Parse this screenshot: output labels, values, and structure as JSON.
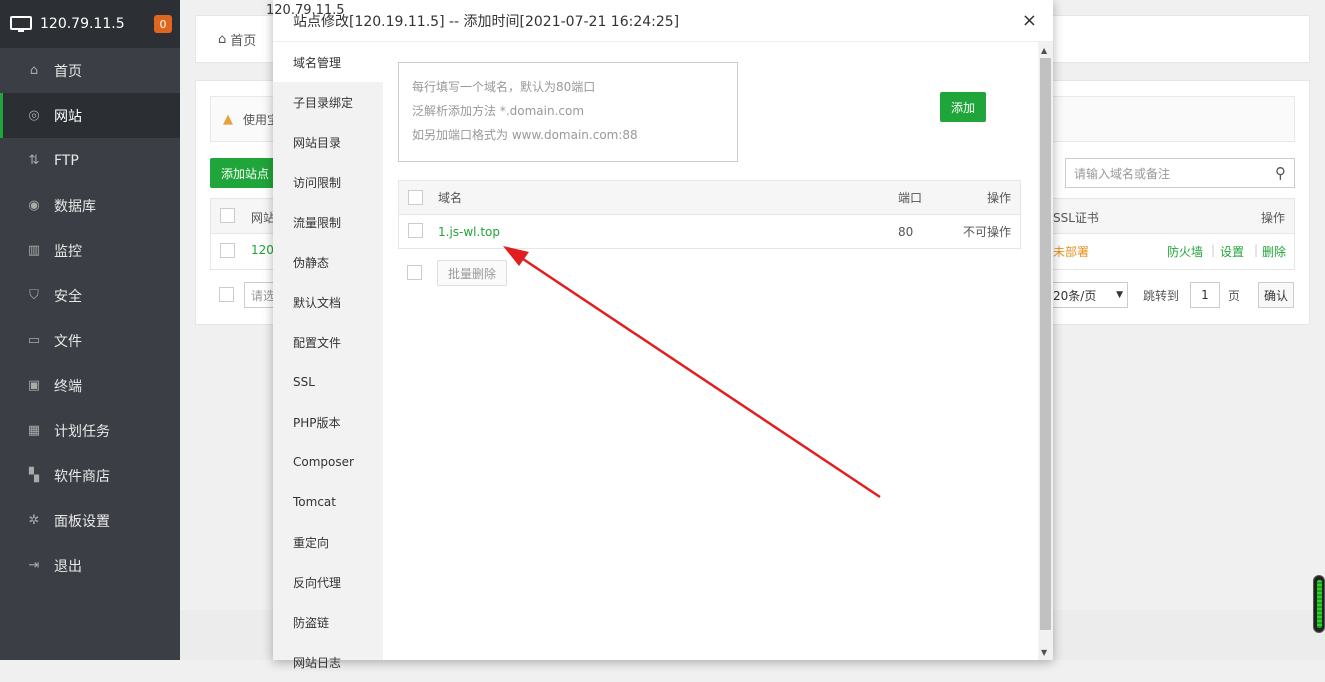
{
  "sidebar": {
    "ip": "120.79.11.5",
    "badge": "0",
    "items": [
      {
        "label": "首页",
        "icon": "home-icon",
        "glyph": "⌂"
      },
      {
        "label": "网站",
        "icon": "globe-icon",
        "glyph": "◎"
      },
      {
        "label": "FTP",
        "icon": "ftp-icon",
        "glyph": "⇅"
      },
      {
        "label": "数据库",
        "icon": "database-icon",
        "glyph": "◉"
      },
      {
        "label": "监控",
        "icon": "monitor-icon",
        "glyph": "▥"
      },
      {
        "label": "安全",
        "icon": "shield-icon",
        "glyph": "⛉"
      },
      {
        "label": "文件",
        "icon": "folder-icon",
        "glyph": "▭"
      },
      {
        "label": "终端",
        "icon": "terminal-icon",
        "glyph": "▣"
      },
      {
        "label": "计划任务",
        "icon": "calendar-icon",
        "glyph": "▦"
      },
      {
        "label": "软件商店",
        "icon": "apps-icon",
        "glyph": "▚"
      },
      {
        "label": "面板设置",
        "icon": "gear-icon",
        "glyph": "✲"
      },
      {
        "label": "退出",
        "icon": "logout-icon",
        "glyph": "⇥"
      }
    ]
  },
  "background": {
    "top_ip": "120.79.11.5",
    "breadcrumb": "首页",
    "warning": "使用宝",
    "add_site": "添加站点",
    "search_placeholder": "请输入域名或备注",
    "header_site": "网站",
    "header_ssl": "SSL证书",
    "header_ops": "操作",
    "row_site": "120",
    "row_ssl": "未部署",
    "row_firewall": "防火墙",
    "row_settings": "设置",
    "row_delete": "删除",
    "sep": "|",
    "batch_placeholder": "请选",
    "page_size": "20条/页",
    "jump_to": "跳转到",
    "page_num": "1",
    "page_unit": "页",
    "confirm": "确认"
  },
  "modal": {
    "title": "站点修改[120.19.11.5] -- 添加时间[2021-07-21 16:24:25]",
    "close": "×",
    "tabs": [
      "域名管理",
      "子目录绑定",
      "网站目录",
      "访问限制",
      "流量限制",
      "伪静态",
      "默认文档",
      "配置文件",
      "SSL",
      "PHP版本",
      "Composer",
      "Tomcat",
      "重定向",
      "反向代理",
      "防盗链",
      "网站日志"
    ],
    "textarea_lines": [
      "每行填写一个域名，默认为80端口",
      "泛解析添加方法 *.domain.com",
      "如另加端口格式为 www.domain.com:88"
    ],
    "add_button": "添加",
    "table": {
      "headers": {
        "domain": "域名",
        "port": "端口",
        "ops": "操作"
      },
      "rows": [
        {
          "domain": "1.js-wl.top",
          "port": "80",
          "ops": "不可操作"
        }
      ]
    },
    "batch_delete": "批量删除"
  },
  "colors": {
    "accent": "#20a53a",
    "sidebar": "#3b3f45",
    "arrow": "#e02020"
  }
}
